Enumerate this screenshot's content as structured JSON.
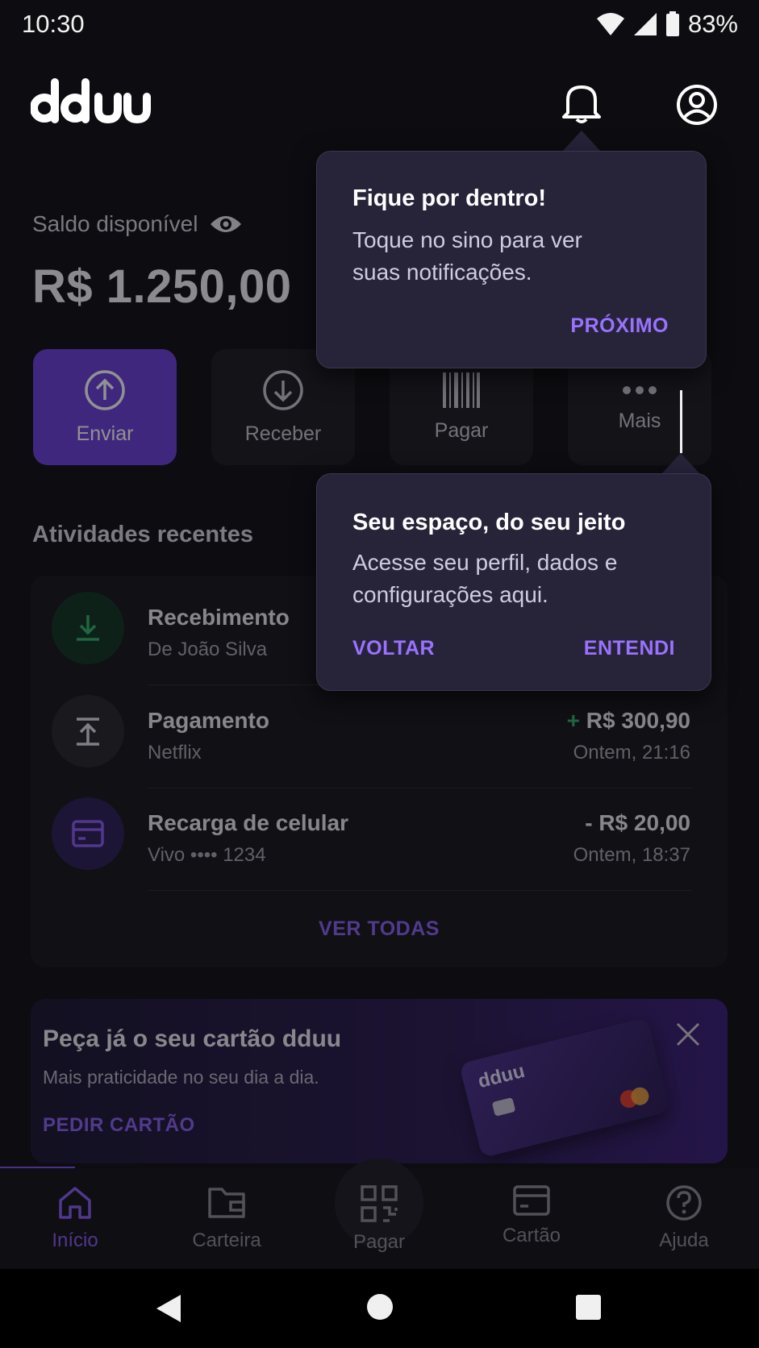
{
  "status_bar": {
    "time": "10:30",
    "battery": "83%"
  },
  "header": {
    "logo_text": "dduu"
  },
  "balance": {
    "label": "Saldo disponível",
    "value": "R$ 1.250,00"
  },
  "actions": [
    {
      "label": "Enviar",
      "icon": "arrow-up-circle-icon"
    },
    {
      "label": "Receber",
      "icon": "arrow-down-circle-icon"
    },
    {
      "label": "Pagar",
      "icon": "barcode-icon"
    },
    {
      "label": "Mais",
      "icon": "more-icon"
    }
  ],
  "recent": {
    "title": "Atividades recentes",
    "items": [
      {
        "title": "Recebimento",
        "subtitle": "De João Silva",
        "amount": "",
        "time": ""
      },
      {
        "title": "Pagamento",
        "subtitle": "Netflix",
        "amount_sign": "+",
        "amount": "R$ 300,90",
        "time": "Ontem, 21:16"
      },
      {
        "title": "Recarga de celular",
        "subtitle": "Vivo •••• 1234",
        "amount": "- R$ 20,00",
        "time": "Ontem, 18:37"
      }
    ],
    "see_all": "VER TODAS"
  },
  "promo": {
    "title": "Peça já o seu cartão dduu",
    "subtitle": "Mais praticidade no seu dia a dia.",
    "cta": "PEDIR CARTÃO",
    "card_logo": "dduu"
  },
  "bottom_nav": [
    {
      "label": "Início",
      "active": true
    },
    {
      "label": "Carteira",
      "active": false
    },
    {
      "label": "Pagar",
      "active": false
    },
    {
      "label": "Cartão",
      "active": false
    },
    {
      "label": "Ajuda",
      "active": false
    }
  ],
  "tooltips": {
    "notifications": {
      "title": "Fique por dentro!",
      "body_line1": "Toque no sino para ver",
      "body_line2": "suas notificações.",
      "next": "PRÓXIMO"
    },
    "profile": {
      "title": "Seu espaço, do seu jeito",
      "body_line1": "Acesse seu perfil, dados e",
      "body_line2": "configurações aqui.",
      "back": "VOLTAR",
      "confirm": "ENTENDI"
    }
  },
  "colors": {
    "accent": "#7c4ff0",
    "background": "#0d0c10",
    "tooltip_bg": "#27243a",
    "positive": "#2fb36a"
  }
}
